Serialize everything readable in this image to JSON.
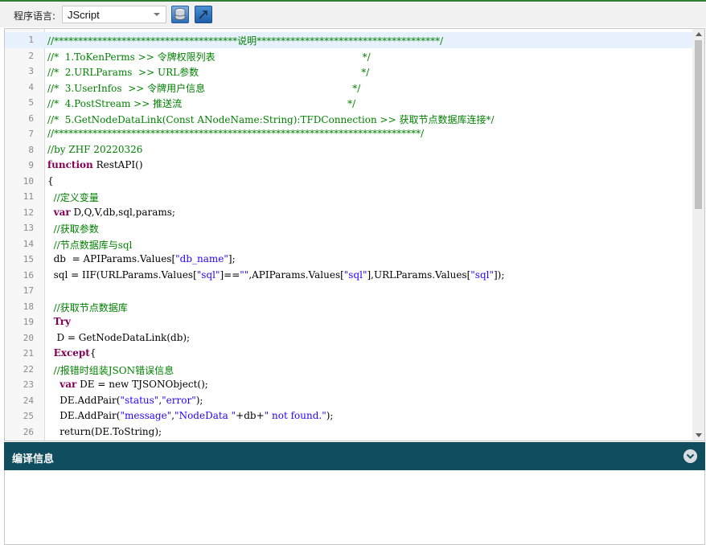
{
  "toolbar": {
    "lang_label": "程序语言:",
    "lang_value": "JScript"
  },
  "editor": {
    "lines": [
      {
        "n": "1",
        "segs": [
          {
            "t": "//**************************************说明**************************************/",
            "c": "cmt"
          }
        ]
      },
      {
        "n": "2",
        "segs": [
          {
            "t": "//*  1.ToKenPerms >> 令牌权限列表                                                */",
            "c": "cmt"
          }
        ]
      },
      {
        "n": "3",
        "segs": [
          {
            "t": "//*  2.URLParams  >> URL参数                                                     */",
            "c": "cmt"
          }
        ]
      },
      {
        "n": "4",
        "segs": [
          {
            "t": "//*  3.UserInfos  >> 令牌用户信息                                                */",
            "c": "cmt"
          }
        ]
      },
      {
        "n": "5",
        "segs": [
          {
            "t": "//*  4.PostStream >> 推送流                                                      */",
            "c": "cmt"
          }
        ]
      },
      {
        "n": "6",
        "segs": [
          {
            "t": "//*  5.GetNodeDataLink(Const ANodeName:String):TFDConnection >> 获取节点数据库连接*/",
            "c": "cmt"
          }
        ]
      },
      {
        "n": "7",
        "segs": [
          {
            "t": "//****************************************************************************/",
            "c": "cmt"
          }
        ]
      },
      {
        "n": "8",
        "segs": [
          {
            "t": "//by ZHF 20220326",
            "c": "cmt"
          }
        ]
      },
      {
        "n": "9",
        "segs": [
          {
            "t": "function",
            "c": "kw"
          },
          {
            "t": " RestAPI()",
            "c": ""
          }
        ]
      },
      {
        "n": "10",
        "segs": [
          {
            "t": "{",
            "c": ""
          }
        ]
      },
      {
        "n": "11",
        "segs": [
          {
            "t": "  //定义变量",
            "c": "cmt"
          }
        ]
      },
      {
        "n": "12",
        "segs": [
          {
            "t": "  ",
            "c": ""
          },
          {
            "t": "var",
            "c": "kw"
          },
          {
            "t": " D,Q,V,db,sql,params;",
            "c": ""
          }
        ]
      },
      {
        "n": "13",
        "segs": [
          {
            "t": "  //获取参数",
            "c": "cmt"
          }
        ]
      },
      {
        "n": "14",
        "segs": [
          {
            "t": "  //节点数据库与sql",
            "c": "cmt"
          }
        ]
      },
      {
        "n": "15",
        "segs": [
          {
            "t": "  db  = APIParams.Values[",
            "c": ""
          },
          {
            "t": "\"db_name\"",
            "c": "str"
          },
          {
            "t": "];",
            "c": ""
          }
        ]
      },
      {
        "n": "16",
        "segs": [
          {
            "t": "  sql = IIF(URLParams.Values[",
            "c": ""
          },
          {
            "t": "\"sql\"",
            "c": "str"
          },
          {
            "t": "]==",
            "c": ""
          },
          {
            "t": "\"\"",
            "c": "str"
          },
          {
            "t": ",APIParams.Values[",
            "c": ""
          },
          {
            "t": "\"sql\"",
            "c": "str"
          },
          {
            "t": "],URLParams.Values[",
            "c": ""
          },
          {
            "t": "\"sql\"",
            "c": "str"
          },
          {
            "t": "]);",
            "c": ""
          }
        ]
      },
      {
        "n": "17",
        "segs": [
          {
            "t": "",
            "c": ""
          }
        ]
      },
      {
        "n": "18",
        "segs": [
          {
            "t": "  //获取节点数据库",
            "c": "cmt"
          }
        ]
      },
      {
        "n": "19",
        "segs": [
          {
            "t": "  ",
            "c": ""
          },
          {
            "t": "Try",
            "c": "kw"
          }
        ]
      },
      {
        "n": "20",
        "segs": [
          {
            "t": "   D = GetNodeDataLink(db);",
            "c": ""
          }
        ]
      },
      {
        "n": "21",
        "segs": [
          {
            "t": "  ",
            "c": ""
          },
          {
            "t": "Except",
            "c": "kw"
          },
          {
            "t": "{",
            "c": ""
          }
        ]
      },
      {
        "n": "22",
        "segs": [
          {
            "t": "  //报错时组装JSON错误信息",
            "c": "cmt"
          }
        ]
      },
      {
        "n": "23",
        "segs": [
          {
            "t": "    ",
            "c": ""
          },
          {
            "t": "var",
            "c": "kw"
          },
          {
            "t": " DE = new TJSONObject();",
            "c": ""
          }
        ]
      },
      {
        "n": "24",
        "segs": [
          {
            "t": "    DE.AddPair(",
            "c": ""
          },
          {
            "t": "\"status\"",
            "c": "str"
          },
          {
            "t": ",",
            "c": ""
          },
          {
            "t": "\"error\"",
            "c": "str"
          },
          {
            "t": ");",
            "c": ""
          }
        ]
      },
      {
        "n": "25",
        "segs": [
          {
            "t": "    DE.AddPair(",
            "c": ""
          },
          {
            "t": "\"message\"",
            "c": "str"
          },
          {
            "t": ",",
            "c": ""
          },
          {
            "t": "\"NodeData \"",
            "c": "str"
          },
          {
            "t": "+db+",
            "c": ""
          },
          {
            "t": "\" not found.\"",
            "c": "str"
          },
          {
            "t": ");",
            "c": ""
          }
        ]
      },
      {
        "n": "26",
        "segs": [
          {
            "t": "    return(DE.ToString);",
            "c": ""
          }
        ]
      }
    ]
  },
  "panel": {
    "title": "编译信息"
  },
  "icons": {
    "db_button": "database-icon",
    "go_button": "run-icon",
    "collapse": "chevron-down-icon"
  },
  "colors": {
    "panel_header": "#0f4d5f",
    "comment": "#008000",
    "keyword": "#7f0055",
    "string": "#2a00ff"
  }
}
